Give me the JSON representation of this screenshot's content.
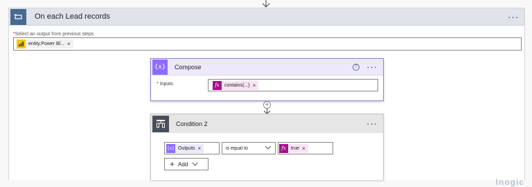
{
  "apply_each": {
    "title": "On each Lead records",
    "more_label": "···",
    "select_required": "*",
    "select_label": "Select an output from previous steps",
    "token": {
      "label": "entity.Power Bl...",
      "remove": "×",
      "icon": "power-bi-icon"
    }
  },
  "compose": {
    "title": "Compose",
    "icon_glyph": "{x}",
    "help_glyph": "?",
    "more_label": "···",
    "inputs_required": "*",
    "inputs_label": "Inputs",
    "token": {
      "label": "contains(...)",
      "remove": "×",
      "icon_glyph": "fx"
    }
  },
  "connector": {
    "plus": "+"
  },
  "condition": {
    "title": "Condition 2",
    "more_label": "···",
    "operand_left": {
      "label": "Outputs",
      "remove": "×",
      "icon_glyph": "{x}"
    },
    "operator": "is equal to",
    "operand_right": {
      "label": "true",
      "remove": "×",
      "icon_glyph": "fx"
    },
    "add_label": "Add"
  },
  "watermark": "Inogic",
  "colors": {
    "apply_each_accent": "#486991",
    "compose_accent": "#8c6cff",
    "expression_accent": "#a5118a",
    "condition_accent": "#484f58",
    "power_bi": "#f2c811"
  }
}
